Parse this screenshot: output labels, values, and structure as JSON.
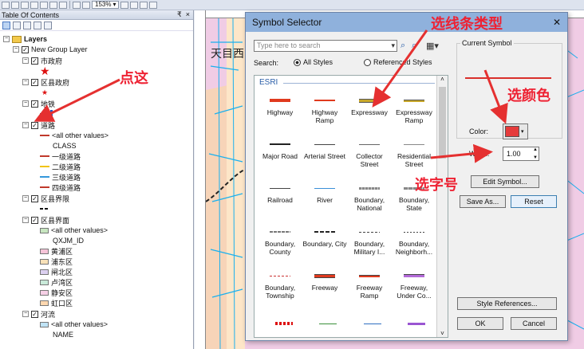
{
  "toolbar": {
    "scale_value": "153%"
  },
  "toc": {
    "title": "Table Of Contents",
    "pin": "₹",
    "close": "×",
    "layers_label": "Layers",
    "group_label": "New Group Layer",
    "items": [
      {
        "label": "市政府",
        "sub": ""
      },
      {
        "label": "区县政府",
        "sub": ""
      },
      {
        "label": "地铁",
        "sub": ""
      },
      {
        "label": "道路",
        "sub": ""
      },
      {
        "label": "区县界限",
        "sub": ""
      },
      {
        "label": "区县界面",
        "sub": ""
      },
      {
        "label": "河流",
        "sub": ""
      }
    ],
    "road_legend": [
      "<all other values>",
      "CLASS",
      "一级道路",
      "二级道路",
      "三级道路",
      "四级道路"
    ],
    "road_colors": [
      "#c0392b",
      "#e67e22",
      "#f1c40f",
      "#3498db",
      "#c0392b"
    ],
    "district_legend": [
      "<all other values>",
      "QXJM_ID",
      "黄浦区",
      "浦东区",
      "闸北区",
      "卢湾区",
      "静安区",
      "虹口区"
    ],
    "district_colors": [
      "#c8e6c0",
      "#f6c4d8",
      "#f8e1b8",
      "#dcd0f0",
      "#c9ead9",
      "#f6d0e6",
      "#ffd8b0"
    ],
    "river_legend": [
      "<all other values>",
      "NAME"
    ]
  },
  "map": {
    "label1": "天目西"
  },
  "dialog": {
    "title": "Symbol Selector",
    "close": "✕",
    "search_placeholder": "Type here to search",
    "search_label": "Search:",
    "all_styles": "All Styles",
    "referenced_styles": "Referenced Styles",
    "gallery_header": "ESRI",
    "symbols": [
      {
        "label": "Highway"
      },
      {
        "label": "Highway Ramp"
      },
      {
        "label": "Expressway"
      },
      {
        "label": "Expressway Ramp"
      },
      {
        "label": "Major Road"
      },
      {
        "label": "Arterial Street"
      },
      {
        "label": "Collector Street"
      },
      {
        "label": "Residential Street"
      },
      {
        "label": "Railroad"
      },
      {
        "label": "River"
      },
      {
        "label": "Boundary, National"
      },
      {
        "label": "Boundary, State"
      },
      {
        "label": "Boundary, County"
      },
      {
        "label": "Boundary, City"
      },
      {
        "label": "Boundary, Military I..."
      },
      {
        "label": "Boundary, Neighborh..."
      },
      {
        "label": "Boundary, Township"
      },
      {
        "label": "Freeway"
      },
      {
        "label": "Freeway Ramp"
      },
      {
        "label": "Freeway, Under Co..."
      }
    ],
    "current_symbol_label": "Current Symbol",
    "color_label": "Color:",
    "color_value": "#e53b3b",
    "width_label": "Width:",
    "width_value": "1.00",
    "edit_symbol": "Edit Symbol...",
    "save_as": "Save As...",
    "reset": "Reset",
    "style_references": "Style References...",
    "ok": "OK",
    "cancel": "Cancel"
  },
  "annotations": {
    "point": "点这",
    "line_type": "选线条类型",
    "color": "选颜色",
    "size": "选字号"
  }
}
